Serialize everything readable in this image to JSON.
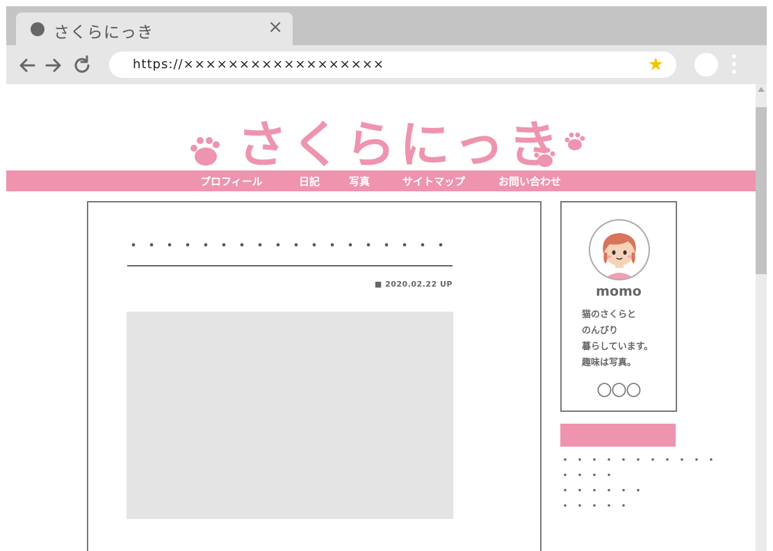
{
  "browser": {
    "tab_title": "さくらにっき",
    "tab_close": "×",
    "url": "https://××××××××××××××××××",
    "star_icon": "★",
    "back_icon": "arrow-left-icon",
    "forward_icon": "arrow-right-icon",
    "reload_icon": "reload-icon"
  },
  "site": {
    "title": "さくらにっき",
    "brand_color": "#ee94ae",
    "nav": [
      "プロフィール",
      "日記",
      "写真",
      "サイトマップ",
      "お問い合わせ"
    ]
  },
  "post": {
    "title": "・・・・・・・・・・・・・・・・・・",
    "date": "■ 2020.02.22 UP"
  },
  "profile": {
    "name": "momo",
    "bio": [
      "猫のさくらと",
      "のんびり",
      "暮らしています。",
      "趣味は写真。"
    ],
    "circles": "〇〇〇"
  },
  "sidebar": {
    "dots": [
      "・・・・・・・・・・・",
      "・・・・",
      "・・・・・・",
      "・・・・・"
    ]
  }
}
